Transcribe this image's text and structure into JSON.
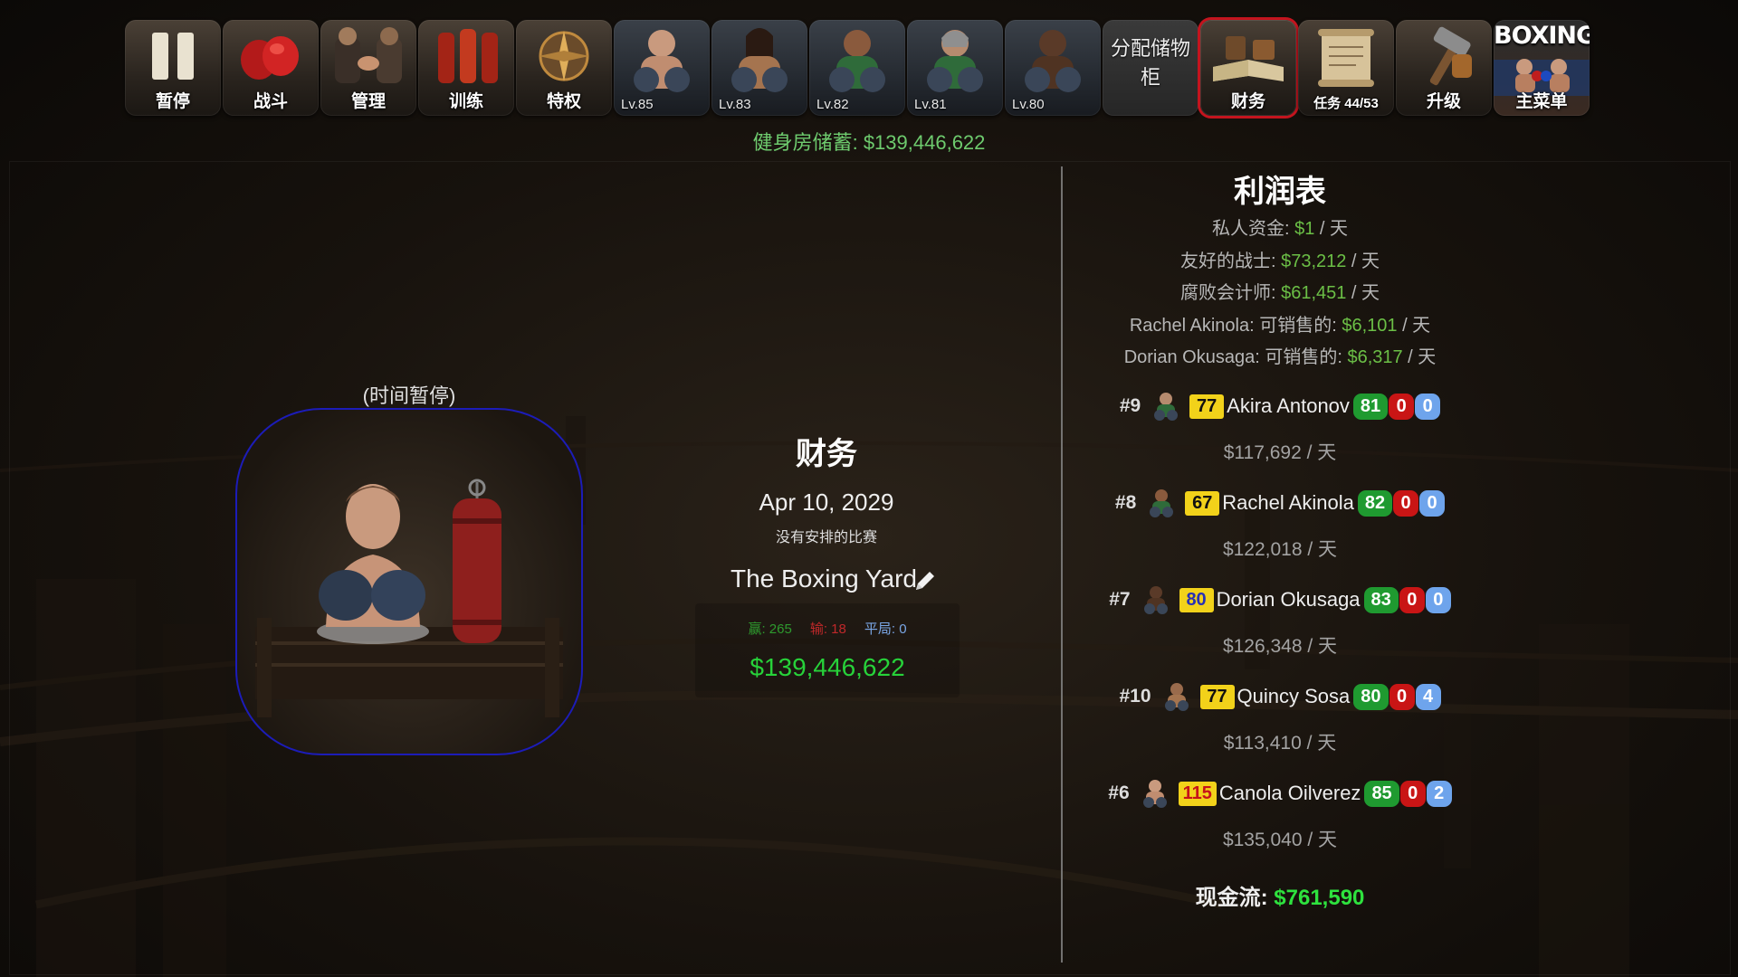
{
  "toolbar": {
    "pause": "暂停",
    "fight": "战斗",
    "manage": "管理",
    "train": "训练",
    "perks": "特权",
    "fighters": [
      {
        "level": "Lv.85"
      },
      {
        "level": "Lv.83"
      },
      {
        "level": "Lv.82"
      },
      {
        "level": "Lv.81"
      },
      {
        "level": "Lv.80"
      }
    ],
    "storage": "分配储物柜",
    "finance": "财务",
    "missions": "任务 44/53",
    "upgrade": "升级",
    "main_menu_logo": "BOXING",
    "main_menu": "主菜单"
  },
  "gym_savings": "健身房储蓄: $139,446,622",
  "left": {
    "paused_label": "(时间暂停)"
  },
  "center": {
    "title": "财务",
    "date": "Apr 10, 2029",
    "no_match": "没有安排的比赛",
    "gym_name": "The Boxing Yard",
    "wins": "赢: 265",
    "losses": "输: 18",
    "draws": "平局: 0",
    "cash": "$139,446,622"
  },
  "income": {
    "title": "利润表",
    "lines": [
      {
        "label": "私人资金: ",
        "amount": "$1",
        "unit": " / 天"
      },
      {
        "label": "友好的战士: ",
        "amount": "$73,212",
        "unit": " / 天"
      },
      {
        "label": "腐败会计师: ",
        "amount": "$61,451",
        "unit": " / 天"
      },
      {
        "label": "Rachel Akinola: 可销售的: ",
        "amount": "$6,101",
        "unit": " / 天"
      },
      {
        "label": "Dorian Okusaga: 可销售的: ",
        "amount": "$6,317",
        "unit": " / 天"
      }
    ],
    "fighters": [
      {
        "rank": "#9",
        "ovr": "77",
        "name": "Akira Antonov",
        "w": "81",
        "l": "0",
        "d": "0",
        "per_day": "$117,692 / 天"
      },
      {
        "rank": "#8",
        "ovr": "67",
        "name": "Rachel Akinola",
        "w": "82",
        "l": "0",
        "d": "0",
        "per_day": "$122,018 / 天"
      },
      {
        "rank": "#7",
        "ovr": "80",
        "name": "Dorian Okusaga",
        "w": "83",
        "l": "0",
        "d": "0",
        "per_day": "$126,348 / 天"
      },
      {
        "rank": "#10",
        "ovr": "77",
        "name": "Quincy Sosa",
        "w": "80",
        "l": "0",
        "d": "4",
        "per_day": "$113,410 / 天"
      },
      {
        "rank": "#6",
        "ovr": "115",
        "name": "Canola Oilverez",
        "w": "85",
        "l": "0",
        "d": "2",
        "per_day": "$135,040 / 天"
      }
    ],
    "cashflow_label": "现金流: ",
    "cashflow_amount": "$761,590"
  },
  "colors": {
    "accent_green": "#27d23a",
    "active_border": "#c4141e",
    "ovr_yellow": "#f2d21a"
  }
}
